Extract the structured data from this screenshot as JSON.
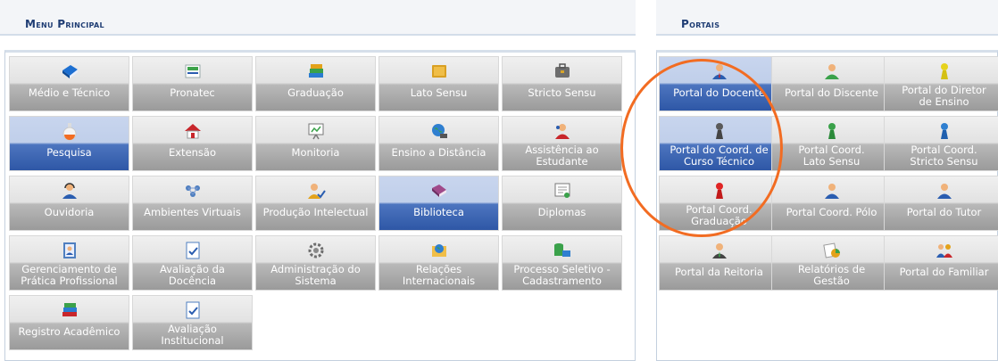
{
  "menu": {
    "title": "Menu Principal",
    "tiles": [
      {
        "label": "Médio e Técnico",
        "icon": "blue-book-icon"
      },
      {
        "label": "Pronatec",
        "icon": "pronatec-logo-icon"
      },
      {
        "label": "Graduação",
        "icon": "books-stack-icon"
      },
      {
        "label": "Lato Sensu",
        "icon": "folder-icon"
      },
      {
        "label": "Stricto Sensu",
        "icon": "briefcase-icon"
      },
      {
        "label": "Pesquisa",
        "icon": "flask-icon"
      },
      {
        "label": "Extensão",
        "icon": "house-icon"
      },
      {
        "label": "Monitoria",
        "icon": "presentation-board-icon"
      },
      {
        "label": "Ensino a Distância",
        "icon": "globe-computer-icon"
      },
      {
        "label": "Assistência ao\nEstudante",
        "icon": "support-user-icon"
      },
      {
        "label": "Ouvidoria",
        "icon": "headset-user-icon"
      },
      {
        "label": "Ambientes Virtuais",
        "icon": "network-icon"
      },
      {
        "label": "Produção Intelectual",
        "icon": "user-check-icon"
      },
      {
        "label": "Biblioteca",
        "icon": "open-book-icon"
      },
      {
        "label": "Diplomas",
        "icon": "certificate-icon"
      },
      {
        "label": "Gerenciamento de\nPrática Profissional",
        "icon": "contact-book-icon"
      },
      {
        "label": "Avaliação da\nDocência",
        "icon": "checklist-icon"
      },
      {
        "label": "Administração do\nSistema",
        "icon": "gear-icon"
      },
      {
        "label": "Relações\nInternacionais",
        "icon": "world-folder-icon"
      },
      {
        "label": "Processo Seletivo -\nCadastramento",
        "icon": "database-computer-icon"
      },
      {
        "label": "Registro Acadêmico",
        "icon": "stacked-books-icon"
      },
      {
        "label": "Avaliação\nInstitucional",
        "icon": "checklist-icon"
      }
    ]
  },
  "portals": {
    "title": "Portais",
    "tiles": [
      {
        "label": "Portal do Docente",
        "icon": "teacher-icon"
      },
      {
        "label": "Portal do Discente",
        "icon": "student-icon"
      },
      {
        "label": "Portal do Diretor\nde Ensino",
        "icon": "yellow-pawn-icon"
      },
      {
        "label": "Portal do Coord. de\nCurso Técnico",
        "icon": "gray-pawn-icon"
      },
      {
        "label": "Portal Coord.\nLato Sensu",
        "icon": "green-pawn-icon"
      },
      {
        "label": "Portal Coord.\nStricto Sensu",
        "icon": "blue-pawn-icon"
      },
      {
        "label": "Portal Coord.\nGraduação",
        "icon": "red-pawn-icon"
      },
      {
        "label": "Portal Coord. Pólo",
        "icon": "user-icon"
      },
      {
        "label": "Portal do Tutor",
        "icon": "user-icon"
      },
      {
        "label": "Portal da Reitoria",
        "icon": "businessman-icon"
      },
      {
        "label": "Relatórios de\nGestão",
        "icon": "reports-icon"
      },
      {
        "label": "Portal do Familiar",
        "icon": "family-icon"
      }
    ]
  },
  "colors": {
    "accent": "#2e57a6",
    "highlight_circle": "#f26c22",
    "title": "#1f3d74"
  }
}
